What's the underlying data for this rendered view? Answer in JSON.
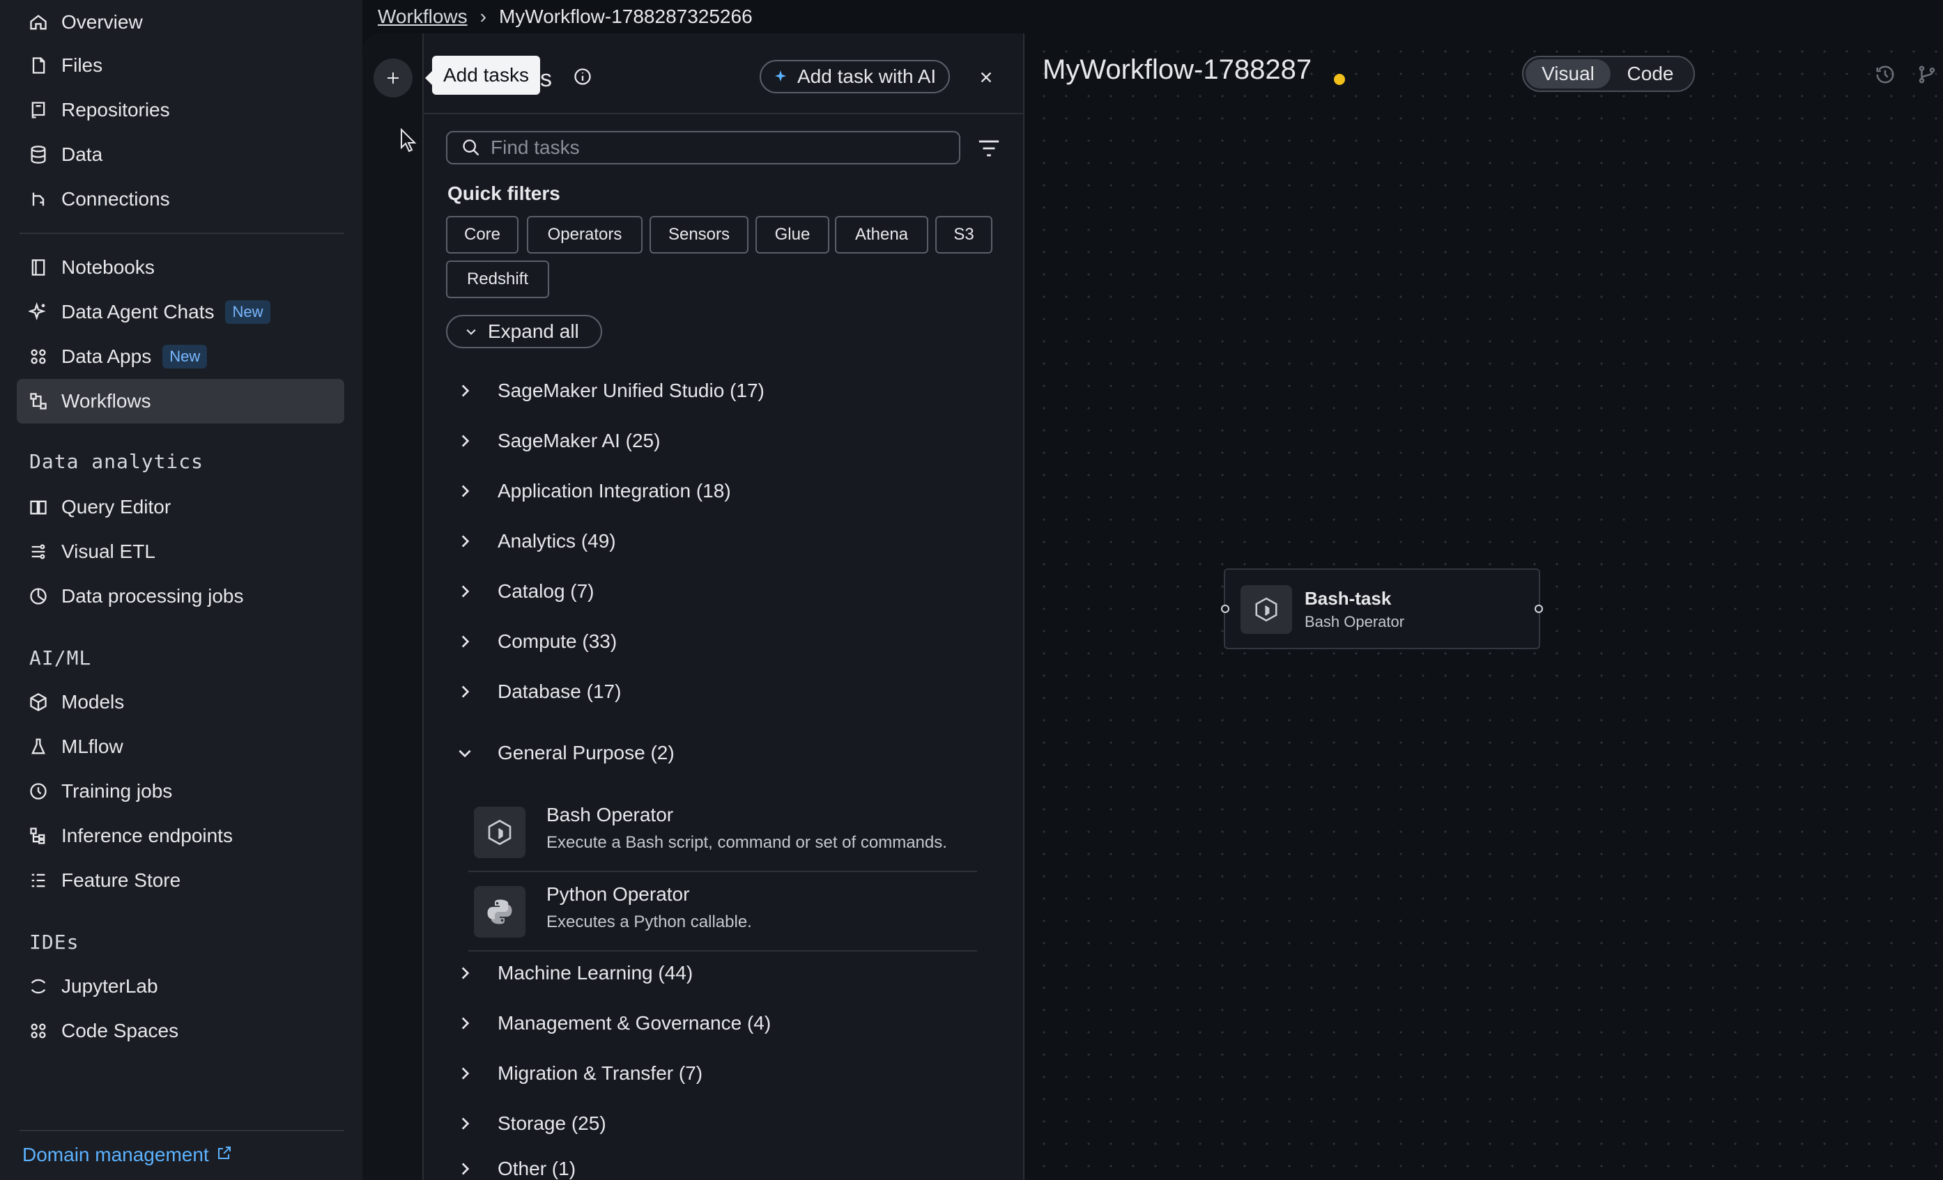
{
  "breadcrumb": {
    "root": "Workflows",
    "current": "MyWorkflow-1788287325266"
  },
  "sidebar": {
    "items_top": [
      {
        "label": "Overview",
        "icon": "home-icon"
      },
      {
        "label": "Files",
        "icon": "file-icon"
      },
      {
        "label": "Repositories",
        "icon": "repository-icon"
      },
      {
        "label": "Data",
        "icon": "database-icon"
      },
      {
        "label": "Connections",
        "icon": "connections-icon"
      }
    ],
    "items_mid": [
      {
        "label": "Notebooks",
        "icon": "notebook-icon"
      },
      {
        "label": "Data Agent Chats",
        "icon": "sparkle-icon",
        "badge": "New"
      },
      {
        "label": "Data Apps",
        "icon": "apps-icon",
        "badge": "New"
      },
      {
        "label": "Workflows",
        "icon": "workflow-icon",
        "active": true
      }
    ],
    "sections": [
      {
        "title": "Data analytics",
        "items": [
          "Query Editor",
          "Visual ETL",
          "Data processing jobs"
        ]
      },
      {
        "title": "AI/ML",
        "items": [
          "Models",
          "MLflow",
          "Training jobs",
          "Inference endpoints",
          "Feature Store"
        ]
      },
      {
        "title": "IDEs",
        "items": [
          "JupyterLab",
          "Code Spaces"
        ]
      }
    ],
    "domain_link": "Domain management"
  },
  "tooltip": "Add tasks",
  "panel": {
    "title_visible_fragment": "ks",
    "ai_button": "Add task with AI",
    "search_placeholder": "Find tasks",
    "quick_filters_title": "Quick filters",
    "chips": [
      "Core",
      "Operators",
      "Sensors",
      "Glue",
      "Athena",
      "S3",
      "Redshift"
    ],
    "expand_all": "Expand all",
    "categories_before": [
      "SageMaker Unified Studio (17)",
      "SageMaker AI (25)",
      "Application Integration (18)",
      "Analytics (49)",
      "Catalog (7)",
      "Compute (33)",
      "Database (17)"
    ],
    "expanded_category": "General Purpose (2)",
    "operators": [
      {
        "name": "Bash Operator",
        "desc": "Execute a Bash script, command or set of commands.",
        "icon": "bash-icon"
      },
      {
        "name": "Python Operator",
        "desc": "Executes a Python callable.",
        "icon": "python-icon"
      }
    ],
    "categories_after": [
      "Machine Learning (44)",
      "Management & Governance (4)",
      "Migration & Transfer (7)",
      "Storage (25)",
      "Other (1)"
    ]
  },
  "canvas": {
    "workflow_title": "MyWorkflow-1788287",
    "toggle": {
      "visual": "Visual",
      "code": "Code",
      "selected": "Visual"
    },
    "node": {
      "name": "Bash-task",
      "type": "Bash Operator"
    },
    "unsaved_color": "#f2c01a"
  },
  "colors": {
    "link": "#5cb2ff",
    "badge_text": "#7ab8ff",
    "background": "#0e1116"
  }
}
